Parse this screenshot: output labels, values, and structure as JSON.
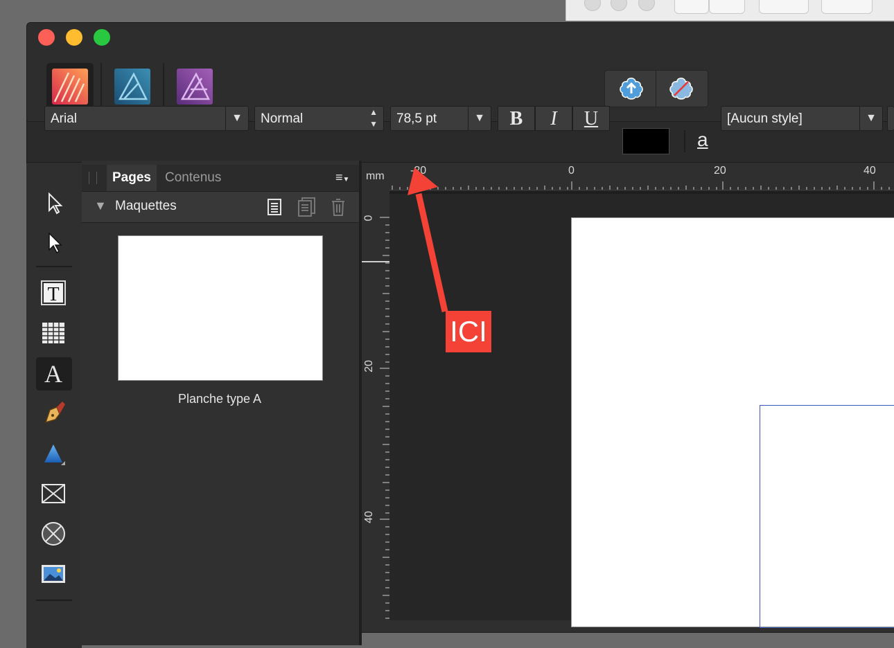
{
  "toolbar": {
    "font_family": "Arial",
    "font_style": "Normal",
    "font_size": "78,5 pt",
    "bold_label": "B",
    "italic_label": "I",
    "underline_label": "U",
    "color_swatch": "#000000",
    "char_style_icon": "a",
    "paragraph_style": "[Aucun style]"
  },
  "panel": {
    "tabs": [
      {
        "label": "Pages",
        "active": true
      },
      {
        "label": "Contenus",
        "active": false
      }
    ],
    "section_title": "Maquettes",
    "master_page_label": "Planche type A"
  },
  "ruler": {
    "unit": "mm",
    "top_labels": [
      "-20",
      "0",
      "20",
      "40"
    ],
    "left_labels": [
      "0",
      "20",
      "40"
    ]
  },
  "annotation": {
    "text": "ICI",
    "color": "#f44336"
  },
  "colors": {
    "close": "#fe5f57",
    "minimize": "#febc2e",
    "zoom": "#28c840",
    "frame_border": "#3a5ab8"
  }
}
